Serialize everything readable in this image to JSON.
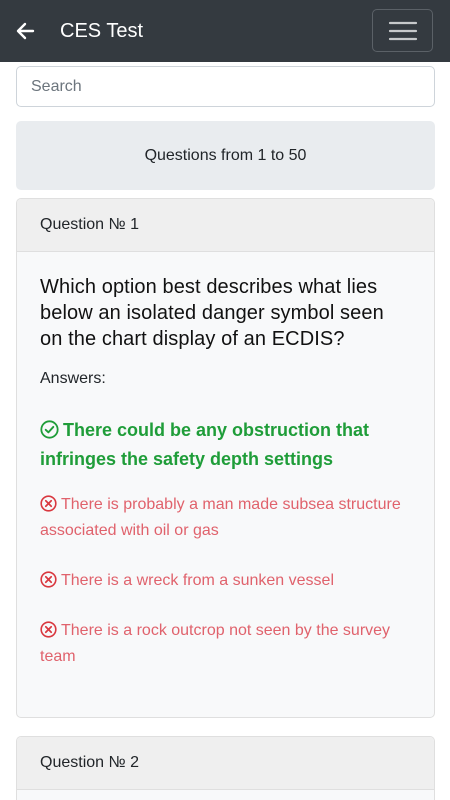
{
  "header": {
    "title": "CES Test",
    "back_icon": "arrow-left-icon",
    "menu_icon": "hamburger-menu-icon"
  },
  "search": {
    "placeholder": "Search",
    "value": ""
  },
  "range": {
    "label": "Questions from 1 to 50"
  },
  "questions": [
    {
      "number_label": "Question № 1",
      "text": "Which option best describes what lies below an isolated danger symbol seen on the chart display of an ECDIS?",
      "answers_label": "Answers:",
      "answers": [
        {
          "text": "There could be any obstruction that infringes the safety depth settings",
          "correct": true,
          "icon": "check-circle-icon"
        },
        {
          "text": "There is probably a man made subsea structure associated with oil or gas",
          "correct": false,
          "icon": "x-circle-icon"
        },
        {
          "text": "There is a wreck from a sunken vessel",
          "correct": false,
          "icon": "x-circle-icon"
        },
        {
          "text": "There is a rock outcrop not seen by the survey team",
          "correct": false,
          "icon": "x-circle-icon"
        }
      ]
    },
    {
      "number_label": "Question № 2"
    }
  ],
  "colors": {
    "appbar": "#343a40",
    "correct": "#1f9d39",
    "wrong": "#e0626c",
    "range_bg": "#e9ecef"
  }
}
